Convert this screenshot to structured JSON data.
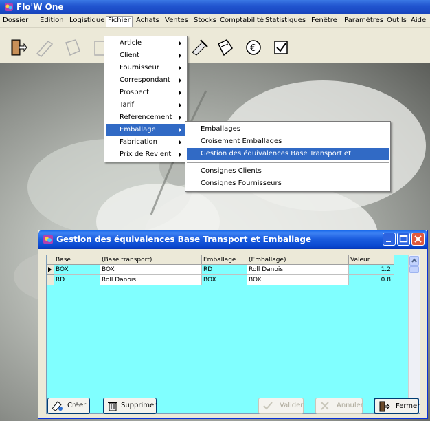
{
  "app": {
    "title": "Flo'W One"
  },
  "menubar": {
    "items": [
      "Dossier",
      "Edition",
      "Logistique",
      "Fichier",
      "Achats",
      "Ventes",
      "Stocks",
      "Comptabilité",
      "Statistiques",
      "Fenêtre",
      "Paramètres",
      "Outils",
      "Aide"
    ],
    "active": "Fichier"
  },
  "fichier_menu": {
    "items": [
      {
        "label": "Article",
        "submenu": true
      },
      {
        "label": "Client",
        "submenu": true
      },
      {
        "label": "Fournisseur",
        "submenu": true
      },
      {
        "label": "Correspondant",
        "submenu": true
      },
      {
        "label": "Prospect",
        "submenu": true
      },
      {
        "label": "Tarif",
        "submenu": true
      },
      {
        "label": "Référencement",
        "submenu": true
      },
      {
        "label": "Emballage",
        "submenu": true,
        "highlighted": true
      },
      {
        "label": "Fabrication",
        "submenu": true
      },
      {
        "label": "Prix de Revient",
        "submenu": true
      }
    ]
  },
  "emballage_submenu": {
    "items": [
      {
        "label": "Emballages"
      },
      {
        "label": "Croisement Emballages"
      },
      {
        "label": "Gestion des équivalences Base Transport et Emballage",
        "highlighted": true
      },
      {
        "label": "Consignes Clients"
      },
      {
        "label": "Consignes Fournisseurs"
      }
    ]
  },
  "dialog": {
    "title": "Gestion des équivalences Base Transport et Emballage",
    "columns": [
      "Base transport",
      "(Base transport)",
      "Emballage",
      "(Emballage)",
      "Valeur"
    ],
    "rows": [
      [
        "BOX",
        "BOX",
        "RD",
        "Roll Danois",
        "1.2"
      ],
      [
        "RD",
        "Roll Danois",
        "BOX",
        "BOX",
        "0.8"
      ]
    ],
    "buttons": {
      "creer": "Créer",
      "supprimer": "Supprimer",
      "valider": "Valider",
      "annuler": "Annuler",
      "fermer": "Fermer"
    }
  },
  "colors": {
    "grid_background": "#80ffff",
    "menu_highlight": "#316ac5",
    "titlebar": "#2155cf"
  }
}
